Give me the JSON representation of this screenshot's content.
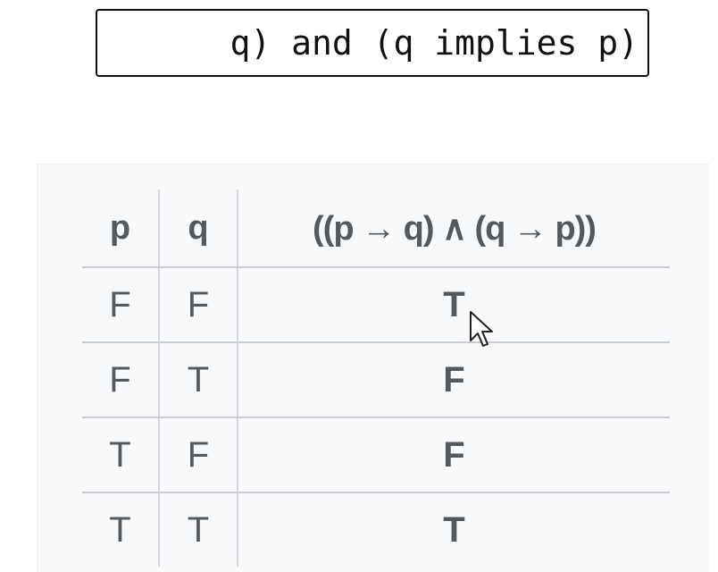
{
  "query": {
    "text": "q) and (q implies p)"
  },
  "truth_table": {
    "headers": {
      "p": "p",
      "q": "q",
      "expression": "((p → q) ∧ (q → p))"
    },
    "rows": [
      {
        "p": "F",
        "q": "F",
        "result": "T"
      },
      {
        "p": "F",
        "q": "T",
        "result": "F"
      },
      {
        "p": "T",
        "q": "F",
        "result": "F"
      },
      {
        "p": "T",
        "q": "T",
        "result": "T"
      }
    ]
  },
  "icons": {
    "cursor": "mouse-pointer-icon"
  },
  "colors": {
    "table_text": "#54595d",
    "panel_background": "#f8f9fa",
    "row_divider": "#c8ccd1",
    "query_border": "#111111"
  }
}
